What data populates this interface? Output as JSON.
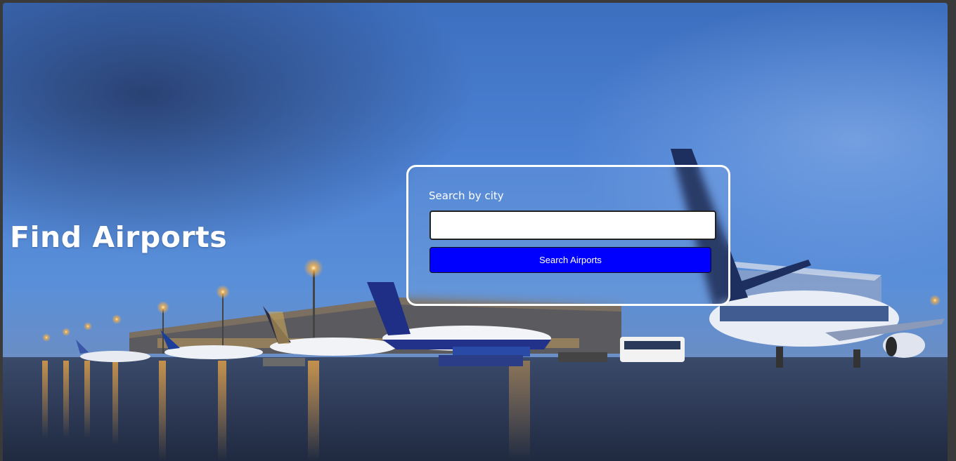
{
  "page": {
    "title": "Find Airports"
  },
  "search": {
    "label": "Search by city",
    "input_value": "",
    "button_label": "Search Airports"
  },
  "colors": {
    "button_bg": "#0000ff",
    "card_border": "#ffffff",
    "sky": "#4a78c8"
  }
}
